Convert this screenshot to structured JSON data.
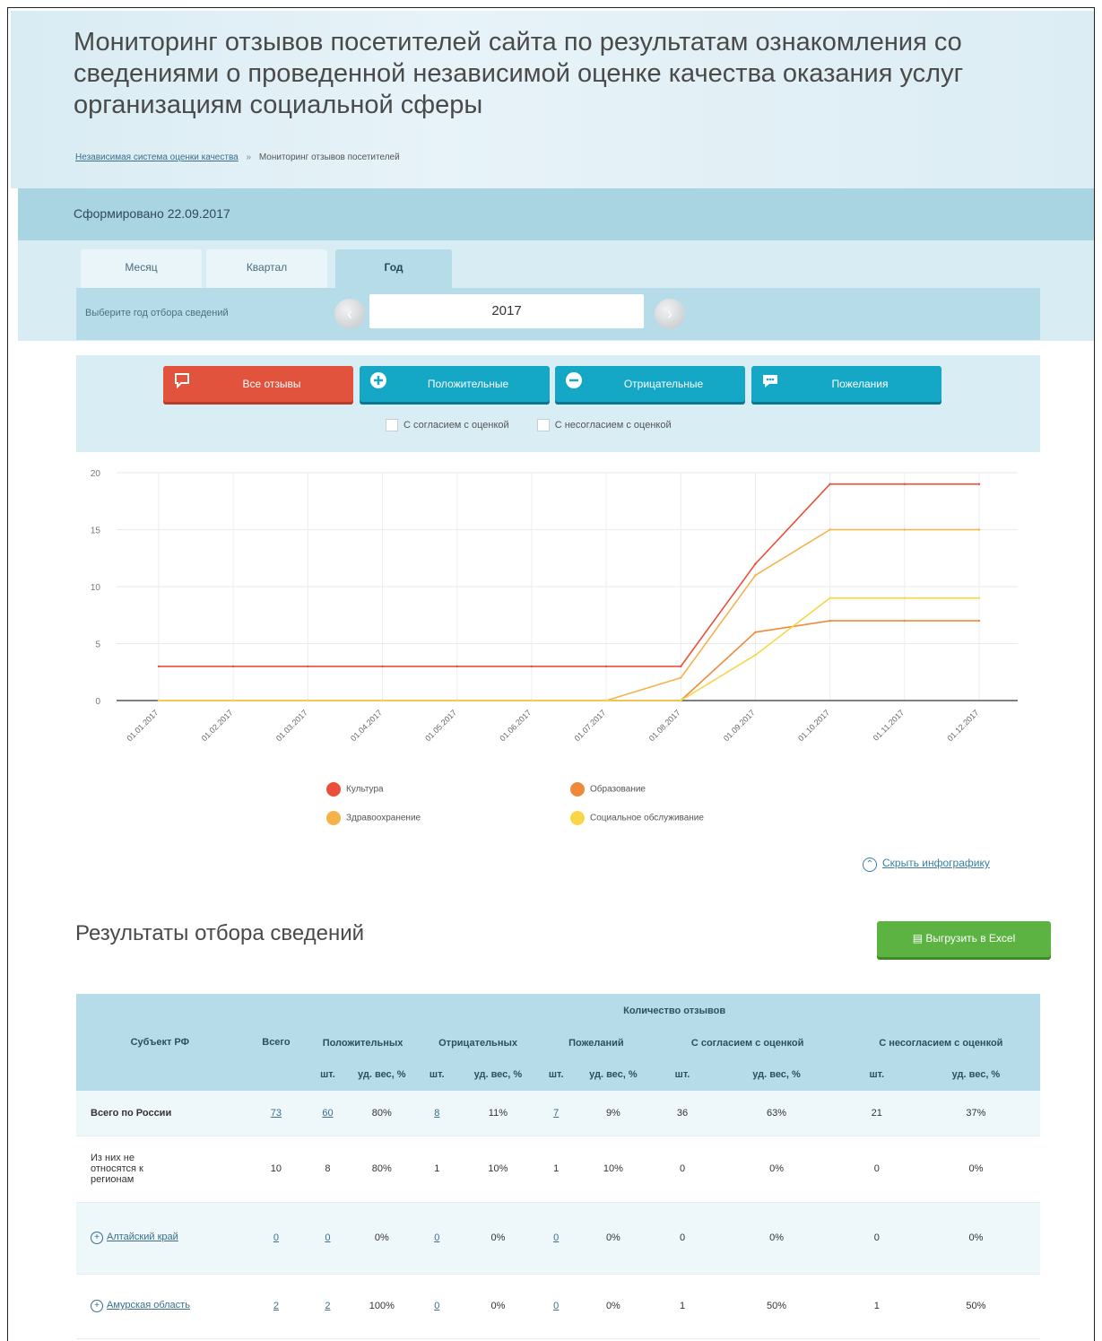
{
  "header": {
    "title": "Мониторинг отзывов посетителей сайта по результатам ознакомления со сведениями о проведенной независимой оценке качества оказания услуг организациям социальной сферы",
    "breadcrumb": {
      "root": "Независимая система оценки качества",
      "separator": "»",
      "current": "Мониторинг отзывов посетителей"
    }
  },
  "formed_label": "Сформировано 22.09.2017",
  "period_tabs": [
    {
      "label": "Месяц",
      "active": false
    },
    {
      "label": "Квартал",
      "active": false
    },
    {
      "label": "Год",
      "active": true
    }
  ],
  "year_selector": {
    "label": "Выберите год отбора сведений",
    "value": "2017",
    "prev_icon": "‹",
    "next_icon": "›"
  },
  "filter_buttons": [
    {
      "label": "Все отзывы",
      "icon": "comment-icon",
      "color": "#e2533d"
    },
    {
      "label": "Положительные",
      "icon": "plus-comment-icon",
      "color": "#14a7c6"
    },
    {
      "label": "Отрицательные",
      "icon": "minus-comment-icon",
      "color": "#14a7c6"
    },
    {
      "label": "Пожелания",
      "icon": "wish-comment-icon",
      "color": "#14a7c6"
    }
  ],
  "checkboxes": [
    {
      "label": "С согласием с оценкой",
      "checked": false
    },
    {
      "label": "С несогласием с оценкой",
      "checked": false
    }
  ],
  "chart_data": {
    "type": "line",
    "x": [
      "01.01.2017",
      "01.02.2017",
      "01.03.2017",
      "01.04.2017",
      "01.05.2017",
      "01.06.2017",
      "01.07.2017",
      "01.08.2017",
      "01.09.2017",
      "01.10.2017",
      "01.11.2017",
      "01.12.2017"
    ],
    "ylim": [
      0,
      20
    ],
    "yticks": [
      0,
      5,
      10,
      15,
      20
    ],
    "grid": true,
    "legend_position": "bottom",
    "series": [
      {
        "name": "Культура",
        "color": "#e8503a",
        "values": [
          3,
          3,
          3,
          3,
          3,
          3,
          3,
          3,
          12,
          19,
          19,
          19
        ]
      },
      {
        "name": "Образование",
        "color": "#f08a3a",
        "values": [
          0,
          0,
          0,
          0,
          0,
          0,
          0,
          0,
          6,
          7,
          7,
          7
        ]
      },
      {
        "name": "Здравоохранение",
        "color": "#f5b24a",
        "values": [
          0,
          0,
          0,
          0,
          0,
          0,
          0,
          2,
          11,
          15,
          15,
          15
        ]
      },
      {
        "name": "Социальное обслуживание",
        "color": "#f7d64a",
        "values": [
          0,
          0,
          0,
          0,
          0,
          0,
          0,
          0,
          4,
          9,
          9,
          9
        ]
      }
    ]
  },
  "hide_link": {
    "icon": "collapse-icon",
    "label": "Скрыть инфографику"
  },
  "results": {
    "title": "Результаты отбора сведений",
    "export_button": "Выгрузить в Excel",
    "headers": {
      "subject": "Субъект РФ",
      "count": "Количество отзывов",
      "total": "Всего",
      "groups": [
        "Положительных",
        "Отрицательных",
        "Пожеланий",
        "С согласием с оценкой",
        "С несогласием с оценкой"
      ],
      "unit_count": "шт.",
      "unit_share": "уд. вес, %"
    },
    "rows": [
      {
        "subject": "Всего по России",
        "bold": true,
        "expandable": false,
        "cells": [
          {
            "v": "73",
            "link": true
          },
          {
            "v": "60",
            "link": true
          },
          {
            "v": "80%"
          },
          {
            "v": "8",
            "link": true
          },
          {
            "v": "11%"
          },
          {
            "v": "7",
            "link": true
          },
          {
            "v": "9%"
          },
          {
            "v": "36"
          },
          {
            "v": "63%"
          },
          {
            "v": "21"
          },
          {
            "v": "37%"
          }
        ]
      },
      {
        "subject": "Из них не относятся к регионам",
        "bold": false,
        "expandable": false,
        "cells": [
          {
            "v": "10"
          },
          {
            "v": "8"
          },
          {
            "v": "80%"
          },
          {
            "v": "1"
          },
          {
            "v": "10%"
          },
          {
            "v": "1"
          },
          {
            "v": "10%"
          },
          {
            "v": "0"
          },
          {
            "v": "0%"
          },
          {
            "v": "0"
          },
          {
            "v": "0%"
          }
        ]
      },
      {
        "subject": "Алтайский край",
        "bold": false,
        "expandable": true,
        "cells": [
          {
            "v": "0",
            "link": true
          },
          {
            "v": "0",
            "link": true
          },
          {
            "v": "0%"
          },
          {
            "v": "0",
            "link": true
          },
          {
            "v": "0%"
          },
          {
            "v": "0",
            "link": true
          },
          {
            "v": "0%"
          },
          {
            "v": "0"
          },
          {
            "v": "0%"
          },
          {
            "v": "0"
          },
          {
            "v": "0%"
          }
        ]
      },
      {
        "subject": "Амурская область",
        "bold": false,
        "expandable": true,
        "cells": [
          {
            "v": "2",
            "link": true
          },
          {
            "v": "2",
            "link": true
          },
          {
            "v": "100%"
          },
          {
            "v": "0",
            "link": true
          },
          {
            "v": "0%"
          },
          {
            "v": "0",
            "link": true
          },
          {
            "v": "0%"
          },
          {
            "v": "1"
          },
          {
            "v": "50%"
          },
          {
            "v": "1"
          },
          {
            "v": "50%"
          }
        ]
      }
    ]
  }
}
